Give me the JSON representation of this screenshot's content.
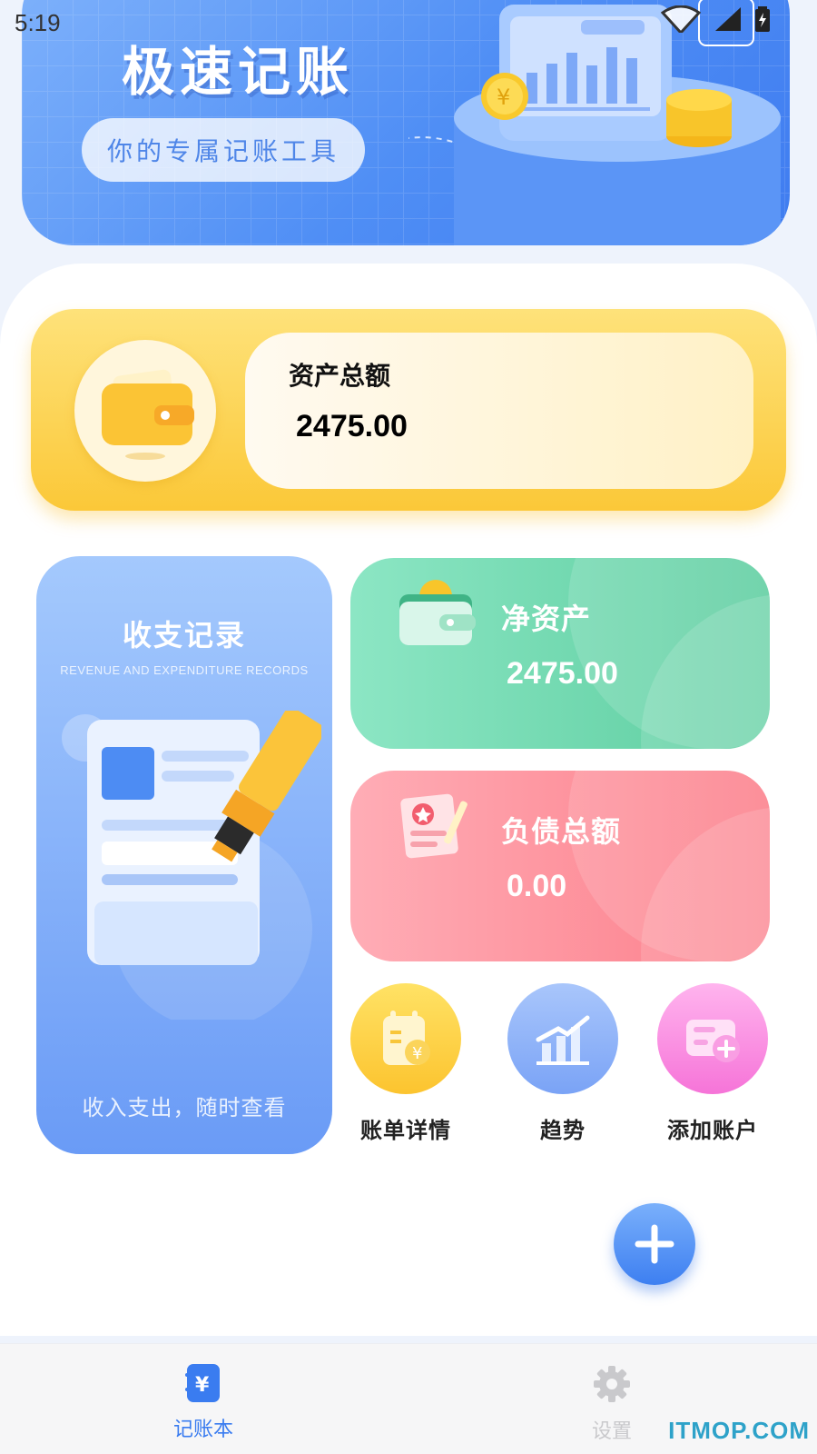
{
  "status_bar": {
    "time": "5:19"
  },
  "banner": {
    "title": "极速记账",
    "subtitle_pill": "你的专属记账工具"
  },
  "asset_card": {
    "label": "资产总额",
    "value": "2475.00"
  },
  "records_card": {
    "title": "收支记录",
    "subtitle": "REVENUE AND EXPENDITURE RECORDS",
    "caption": "收入支出，随时查看"
  },
  "net_asset_card": {
    "label": "净资产",
    "value": "2475.00"
  },
  "debt_card": {
    "label": "负债总额",
    "value": "0.00"
  },
  "quick_actions": [
    {
      "label": "账单详情",
      "icon": "bill-calendar-icon"
    },
    {
      "label": "趋势",
      "icon": "trend-chart-icon"
    },
    {
      "label": "添加账户",
      "icon": "add-card-icon"
    }
  ],
  "bottom_nav": {
    "items": [
      {
        "label": "记账本",
        "icon": "ledger-icon",
        "active": true
      },
      {
        "label": "设置",
        "icon": "gear-icon",
        "active": false
      }
    ]
  },
  "watermark": "ITMOP.COM",
  "colors": {
    "primary_blue": "#4f8ef5",
    "asset_yellow": "#fbc838",
    "net_green": "#5ccd9f",
    "debt_red": "#fc7d89",
    "nav_active": "#3a7cf0",
    "nav_inactive": "#c9c9cc"
  }
}
